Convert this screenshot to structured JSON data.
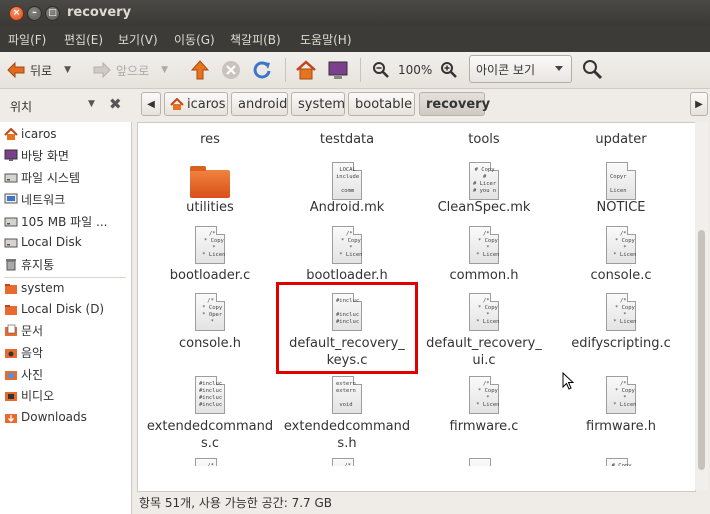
{
  "window": {
    "title": "recovery"
  },
  "menu": [
    "파일(F)",
    "편집(E)",
    "보기(V)",
    "이동(G)",
    "책갈피(B)",
    "도움말(H)"
  ],
  "toolbar": {
    "back": "뒤로",
    "forward": "앞으로",
    "zoom": "100%",
    "view_mode": "아이콘 보기"
  },
  "location": {
    "label": "위치",
    "crumbs": [
      "icaros",
      "android",
      "system",
      "bootable",
      "recovery"
    ]
  },
  "sidebar": [
    {
      "label": "icaros",
      "icon": "home-icon"
    },
    {
      "label": "바탕 화면",
      "icon": "desktop-icon"
    },
    {
      "label": "파일 시스템",
      "icon": "drive-icon"
    },
    {
      "label": "네트워크",
      "icon": "network-icon"
    },
    {
      "label": "105 MB 파일 ...",
      "icon": "drive-icon"
    },
    {
      "label": "Local Disk",
      "icon": "drive-icon"
    },
    {
      "label": "휴지통",
      "icon": "trash-icon"
    },
    {
      "label": "system",
      "icon": "folder-icon"
    },
    {
      "label": "Local Disk (D)",
      "icon": "folder-icon"
    },
    {
      "label": "문서",
      "icon": "documents-icon"
    },
    {
      "label": "음악",
      "icon": "music-icon"
    },
    {
      "label": "사진",
      "icon": "pictures-icon"
    },
    {
      "label": "비디오",
      "icon": "video-icon"
    },
    {
      "label": "Downloads",
      "icon": "downloads-icon"
    }
  ],
  "files": [
    {
      "name": "res",
      "type": "folder"
    },
    {
      "name": "testdata",
      "type": "folder"
    },
    {
      "name": "tools",
      "type": "folder"
    },
    {
      "name": "updater",
      "type": "folder"
    },
    {
      "name": "utilities",
      "type": "folder"
    },
    {
      "name": "Android.mk",
      "type": "text",
      "preview": "LOCAL\ninclude\n\ncomm"
    },
    {
      "name": "CleanSpec.mk",
      "type": "text",
      "preview": "# Copy\n#\n# Licer\n# you n"
    },
    {
      "name": "NOTICE",
      "type": "text",
      "preview": "\nCopyr\n\nLicen"
    },
    {
      "name": "bootloader.c",
      "type": "text",
      "preview": "/*\n * Copy\n *\n * Licen"
    },
    {
      "name": "bootloader.h",
      "type": "text",
      "preview": "/*\n * Copy\n *\n * Licen"
    },
    {
      "name": "common.h",
      "type": "text",
      "preview": "/*\n * Copy\n *\n * Licen"
    },
    {
      "name": "console.c",
      "type": "text",
      "preview": "/*\n * Copy\n *\n * Licen"
    },
    {
      "name": "console.h",
      "type": "text",
      "preview": "/*\n * Copy\n * Oper\n *"
    },
    {
      "name": "default_recovery_\nkeys.c",
      "type": "text",
      "preview": "#incluc\n\n#incluc\n#incluc"
    },
    {
      "name": "default_recovery_\nui.c",
      "type": "text",
      "preview": "/*\n * Copy\n *\n * Licen"
    },
    {
      "name": "edifyscripting.c",
      "type": "text",
      "preview": "/*\n * Copy\n *\n * Licen"
    },
    {
      "name": "extendedcommand\ns.c",
      "type": "text",
      "preview": "#incluc\n#incluc\n#incluc\n#incluc"
    },
    {
      "name": "extendedcommand\ns.h",
      "type": "text",
      "preview": "extern\nextern\n\nvoid"
    },
    {
      "name": "firmware.c",
      "type": "text",
      "preview": "/*\n * Copy\n *\n * Licen"
    },
    {
      "name": "firmware.h",
      "type": "text",
      "preview": "/*\n * Copy\n *\n * Licen"
    },
    {
      "name": "",
      "type": "text",
      "preview": "/*\n * Copy\n *"
    },
    {
      "name": "",
      "type": "text",
      "preview": "/*\n * Copy\n *"
    },
    {
      "name": "",
      "type": "text",
      "preview": ""
    },
    {
      "name": "",
      "type": "text",
      "preview": "# Copy\n#\n# Licer"
    }
  ],
  "status": "항목 51개, 사용 가능한 공간: 7.7 GB",
  "colors": {
    "selection_box": "#e00000",
    "folder": "#e86a2f",
    "titlebar": "#3c3b37"
  }
}
